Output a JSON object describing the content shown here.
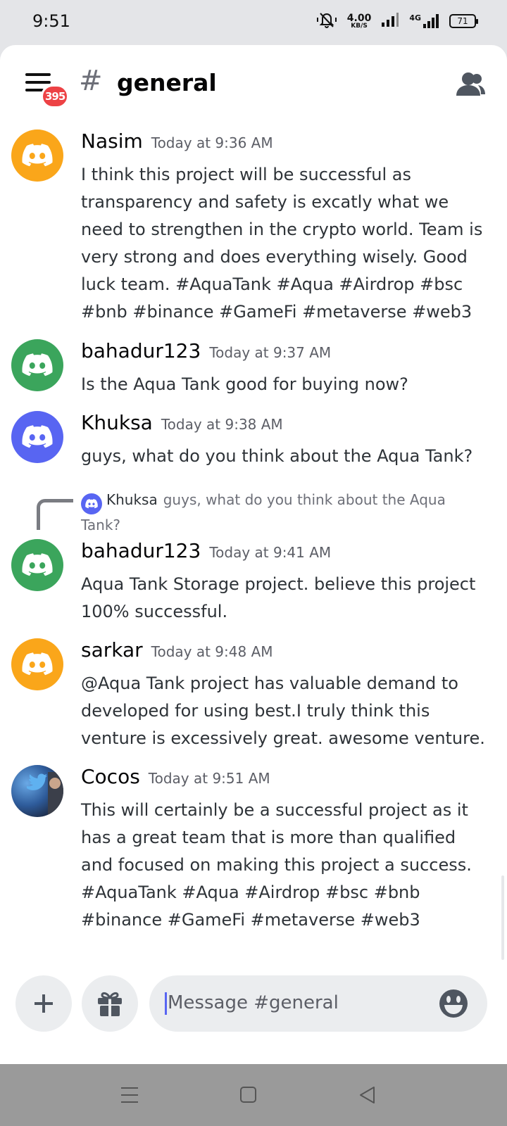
{
  "status_bar": {
    "time": "9:51",
    "net_speed_value": "4.00",
    "net_speed_unit": "KB/S",
    "network_type": "4G",
    "battery": "71"
  },
  "header": {
    "menu_badge": "395",
    "channel_hash": "#",
    "channel_name": "general"
  },
  "messages": [
    {
      "author": "Nasim",
      "time": "Today at 9:36 AM",
      "avatar_color": "#faa61a",
      "text": "I think this project will be successful as transparency and safety is excatly what we need to strengthen in the crypto world. Team is very strong and does everything wisely. Good luck team.  #AquaTank #Aqua #Airdrop #bsc #bnb #binance #GameFi #metaverse #web3"
    },
    {
      "author": "bahadur123",
      "time": "Today at 9:37 AM",
      "avatar_color": "#3ba55c",
      "text": "Is the Aqua Tank good for buying now?"
    },
    {
      "author": "Khuksa",
      "time": "Today at 9:38 AM",
      "avatar_color": "#5865f2",
      "text": "guys, what do you think about the Aqua Tank?"
    },
    {
      "author": "bahadur123",
      "time": "Today at 9:41 AM",
      "avatar_color": "#3ba55c",
      "text": "Aqua Tank Storage project.  believe this project 100% successful.",
      "reply_to": {
        "author": "Khuksa",
        "text": "guys, what do you think about the Aqua Tank?"
      }
    },
    {
      "author": "sarkar",
      "time": "Today at 9:48 AM",
      "avatar_color": "#faa61a",
      "text": "@Aqua Tank project has valuable demand to developed for using best.I truly think this venture is excessively great. awesome venture."
    },
    {
      "author": "Cocos",
      "time": "Today at 9:51 AM",
      "avatar_color": "#2e5b9a",
      "text": "This will certainly be a successful project as it has a great team that is more than qualified and focused on making this project a success. #AquaTank #Aqua #Airdrop #bsc #bnb #binance #GameFi #metaverse #web3"
    }
  ],
  "composer": {
    "placeholder": "Message #general",
    "icons": [
      "plus-icon",
      "gift-icon",
      "emoji-icon"
    ]
  },
  "nav_bar": {
    "icons": [
      "recents-icon",
      "home-icon",
      "back-icon"
    ]
  },
  "colors": {
    "blurple": "#5865f2",
    "badge_red": "#ed4245"
  }
}
